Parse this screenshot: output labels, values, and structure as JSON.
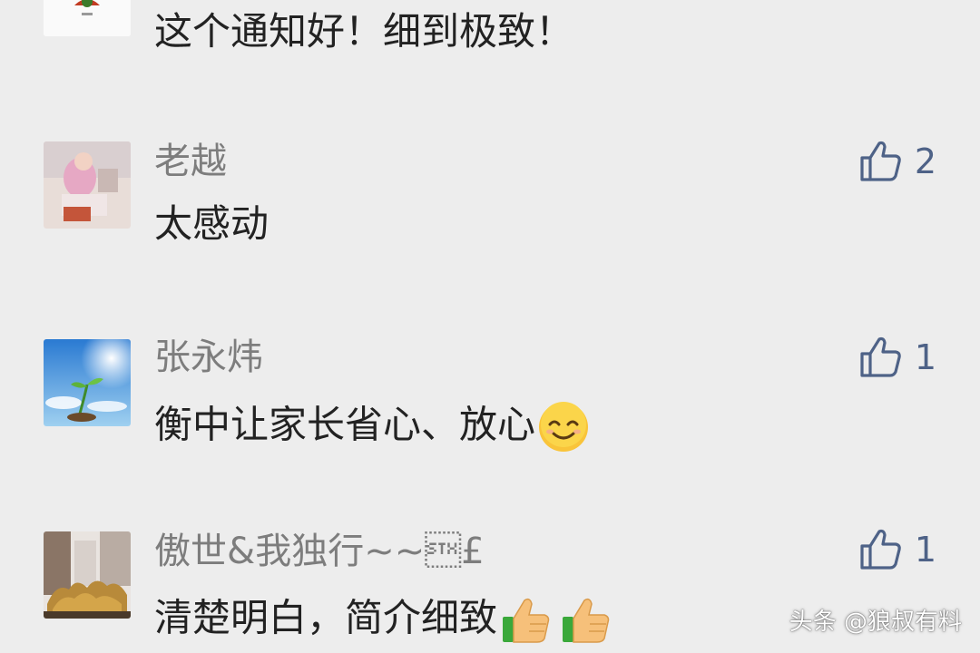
{
  "comments": [
    {
      "name": "",
      "text": "这个通知好！细到极致！",
      "likes": "",
      "avatar": "red-logo-avatar"
    },
    {
      "name": "老越",
      "text": "太感动",
      "likes": "2",
      "avatar": "photo-avatar"
    },
    {
      "name": "张永炜",
      "text": "衡中让家长省心、放心",
      "likes": "1",
      "avatar": "sky-sprout-avatar",
      "emoji": "smiling-face-emoji"
    },
    {
      "name": "傲世&我独行~~\u0002£",
      "text": "清楚明白，简介细致",
      "likes": "1",
      "avatar": "golden-horses-avatar",
      "emoji": "thumbs-up-emoji"
    }
  ],
  "watermark": "头条 @狼叔有料",
  "colors": {
    "background": "#ededed",
    "name": "#7d7d7d",
    "text": "#222222",
    "like": "#4e6287"
  }
}
